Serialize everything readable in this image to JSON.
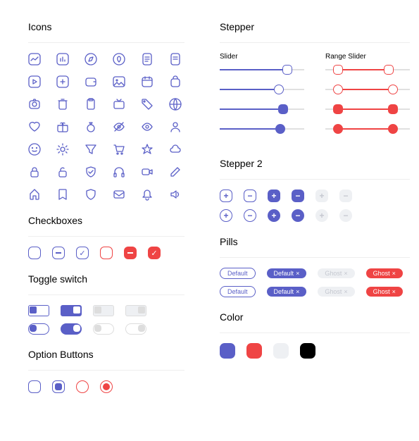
{
  "sections": {
    "icons": "Icons",
    "checkboxes": "Checkboxes",
    "toggle": "Toggle switch",
    "option": "Option Buttons",
    "stepper": "Stepper",
    "slider": "Slider",
    "range": "Range Slider",
    "stepper2": "Stepper 2",
    "pills": "Pills",
    "color": "Color"
  },
  "pills": {
    "default": "Default",
    "ghost": "Ghost"
  },
  "colors": {
    "blue": "#5a5fc7",
    "red": "#ef4444",
    "light": "#eef0f3",
    "black": "#000000"
  },
  "chart_data": {
    "type": "table",
    "note": "UI component gallery, not a data chart"
  }
}
